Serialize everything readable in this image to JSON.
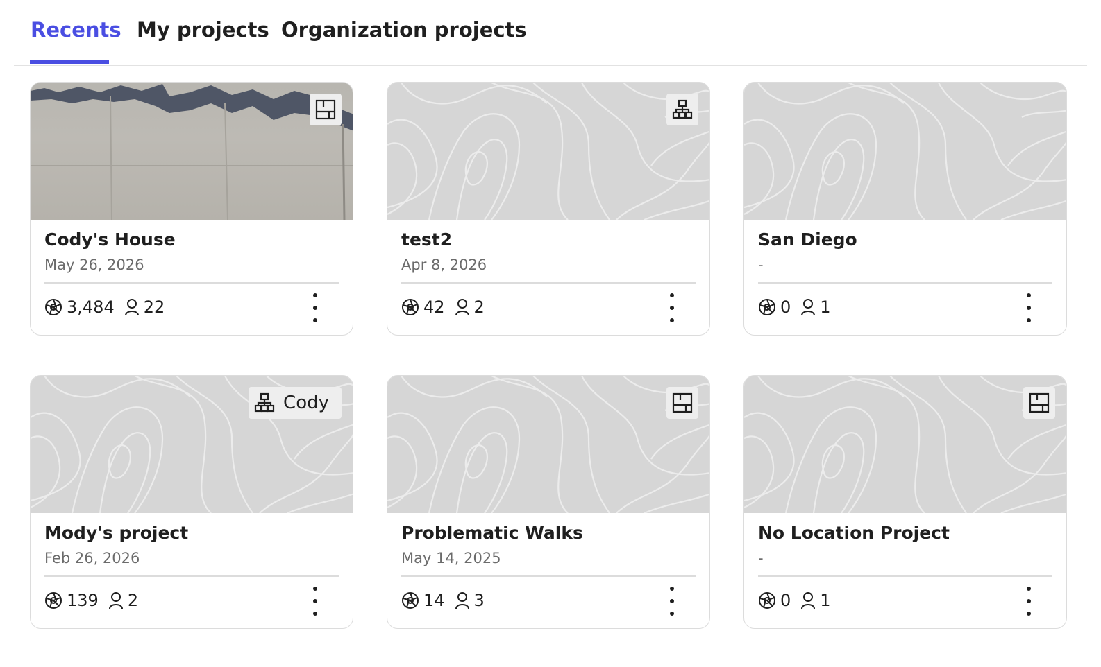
{
  "tabs": [
    {
      "label": "Recents",
      "active": true
    },
    {
      "label": "My projects",
      "active": false
    },
    {
      "label": "Organization projects",
      "active": false
    }
  ],
  "colors": {
    "accent": "#4a4ee2",
    "thumb_bg": "#d6d6d6",
    "badge_bg": "#eeeeee"
  },
  "projects": [
    {
      "title": "Cody's House",
      "date": "May 26, 2026",
      "photos": "3,484",
      "members": "22",
      "badge_icon": "floorplan-icon",
      "badge_text": "",
      "thumb": "photo"
    },
    {
      "title": "test2",
      "date": "Apr 8, 2026",
      "photos": "42",
      "members": "2",
      "badge_icon": "org-chart-icon",
      "badge_text": "",
      "thumb": "topo"
    },
    {
      "title": "San Diego",
      "date": "-",
      "photos": "0",
      "members": "1",
      "badge_icon": "",
      "badge_text": "",
      "thumb": "topo"
    },
    {
      "title": "Mody's project",
      "date": "Feb 26, 2026",
      "photos": "139",
      "members": "2",
      "badge_icon": "org-chart-icon",
      "badge_text": "Cody",
      "thumb": "topo"
    },
    {
      "title": "Problematic Walks",
      "date": "May 14, 2025",
      "photos": "14",
      "members": "3",
      "badge_icon": "floorplan-icon",
      "badge_text": "",
      "thumb": "topo"
    },
    {
      "title": "No Location Project",
      "date": "-",
      "photos": "0",
      "members": "1",
      "badge_icon": "floorplan-icon",
      "badge_text": "",
      "thumb": "topo"
    }
  ]
}
